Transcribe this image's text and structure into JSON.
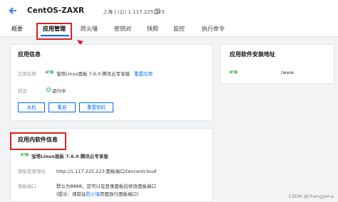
{
  "header": {
    "title": "CentOS-ZAXR",
    "region": "上海 | (公) 1.117.225.223"
  },
  "tabs": [
    {
      "label": "概要"
    },
    {
      "label": "应用管理"
    },
    {
      "label": "防火墙"
    },
    {
      "label": "密钥对"
    },
    {
      "label": "快照"
    },
    {
      "label": "监控"
    },
    {
      "label": "执行命令"
    }
  ],
  "app_info": {
    "title": "应用信息",
    "app_label": "应用名称",
    "app_logo": "BT面",
    "app_name": "宝塔Linux面板 7.6.0 腾讯云专享版",
    "reset_link": "重置应用",
    "status_label": "状态",
    "status_value": "运行中",
    "buttons": {
      "shutdown": "关机",
      "restart": "重启",
      "reset_password": "重置密码"
    }
  },
  "install_addr": {
    "title": "应用软件安装地址",
    "logo": "BT面",
    "path": "/www"
  },
  "software_info": {
    "title": "应用内软件信息",
    "logo": "BT面",
    "name": "宝塔Linux面板 7.6.0 腾讯云专享版",
    "panel_addr_label": "面板登录地址",
    "panel_addr_value": "http://1.117.225.223:面板端口/tencentcloud",
    "panel_port_label": "面板端口",
    "panel_port_value": "默认为8888，您可以在登录面板后修改面板端口",
    "hint_prefix": "(提示：请前往",
    "hint_link": "防火墙",
    "hint_suffix": "页面放行面板端口)"
  },
  "watermark": "CSDN @changyana",
  "colors": {
    "accent": "#006eff",
    "highlight": "#e02020",
    "status_ok": "#0abf5b",
    "bt_green": "#20a53a"
  }
}
